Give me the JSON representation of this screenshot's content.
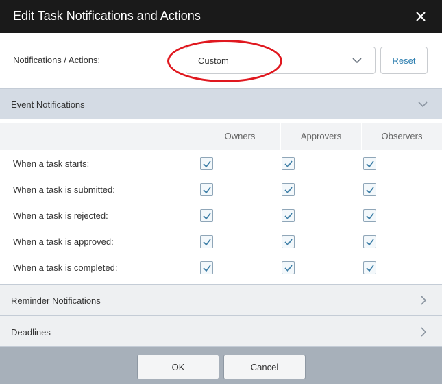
{
  "dialog": {
    "title": "Edit Task Notifications and Actions",
    "close_icon": "close-icon"
  },
  "notifications_actions": {
    "label": "Notifications / Actions:",
    "selected_value": "Custom",
    "reset_label": "Reset",
    "highlight_color": "#e0181f"
  },
  "event_notifications": {
    "title": "Event Notifications",
    "expanded": true,
    "columns": [
      "Owners",
      "Approvers",
      "Observers"
    ],
    "rows": [
      {
        "label": "When a task starts:",
        "checks": [
          true,
          true,
          true
        ]
      },
      {
        "label": "When a task is submitted:",
        "checks": [
          true,
          true,
          true
        ]
      },
      {
        "label": "When a task is rejected:",
        "checks": [
          true,
          true,
          true
        ]
      },
      {
        "label": "When a task is approved:",
        "checks": [
          true,
          true,
          true
        ]
      },
      {
        "label": "When a task is completed:",
        "checks": [
          true,
          true,
          true
        ]
      }
    ]
  },
  "reminder_notifications": {
    "title": "Reminder Notifications",
    "expanded": false
  },
  "deadlines": {
    "title": "Deadlines",
    "expanded": false
  },
  "footer": {
    "ok_label": "OK",
    "cancel_label": "Cancel"
  },
  "colors": {
    "titlebar": "#1a1a1a",
    "accent_link": "#2e7fb0",
    "section_expanded": "#d4dbe4",
    "footer": "#a7b0ba"
  }
}
